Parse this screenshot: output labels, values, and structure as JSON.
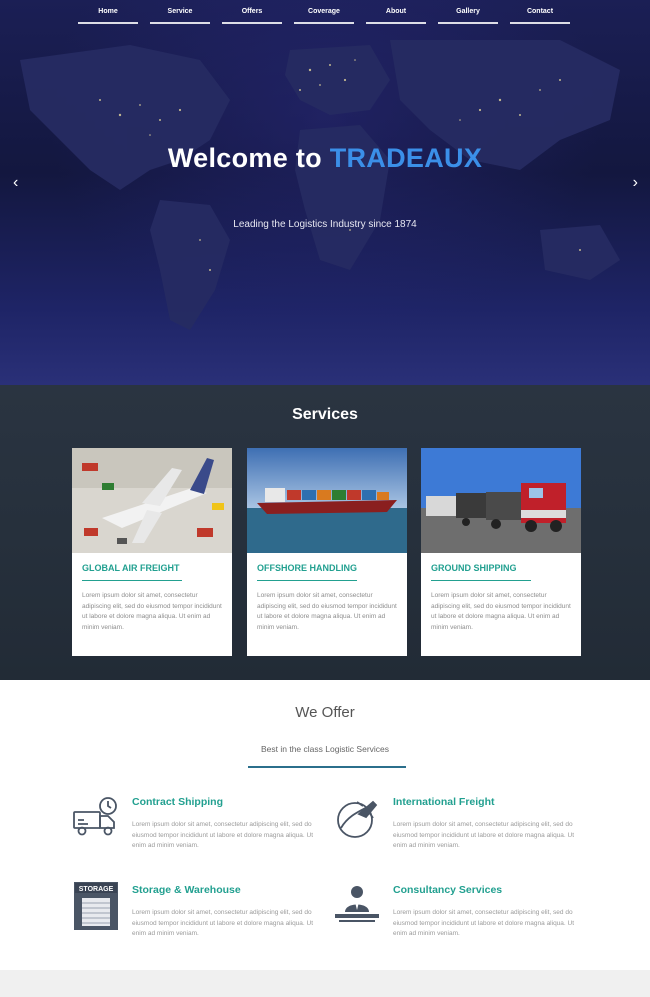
{
  "nav": {
    "items": [
      "Home",
      "Service",
      "Offers",
      "Coverage",
      "About",
      "Gallery",
      "Contact"
    ]
  },
  "hero": {
    "title_prefix": "Welcome to",
    "title_brand": "TRADEAUX",
    "subtitle": "Leading the Logistics Industry since 1874",
    "prev_glyph": "‹",
    "next_glyph": "›"
  },
  "services": {
    "title": "Services",
    "cards": [
      {
        "title": "GLOBAL AIR FREIGHT",
        "text": "Lorem ipsum dolor sit amet, consectetur adipiscing elit, sed do eiusmod tempor incididunt ut labore et dolore magna aliqua. Ut enim ad minim veniam."
      },
      {
        "title": "OFFSHORE HANDLING",
        "text": "Lorem ipsum dolor sit amet, consectetur adipiscing elit, sed do eiusmod tempor incididunt ut labore et dolore magna aliqua. Ut enim ad minim veniam."
      },
      {
        "title": "GROUND SHIPPING",
        "text": "Lorem ipsum dolor sit amet, consectetur adipiscing elit, sed do eiusmod tempor incididunt ut labore et dolore magna aliqua. Ut enim ad minim veniam."
      }
    ]
  },
  "offer": {
    "title": "We Offer",
    "subtitle": "Best in the class Logistic Services",
    "items": [
      {
        "title": "Contract Shipping",
        "icon": "delivery-truck-clock-icon",
        "text": "Lorem ipsum dolor sit amet, consectetur adipiscing elit, sed do eiusmod tempor incididunt ut labore et dolore magna aliqua. Ut enim ad minim veniam."
      },
      {
        "title": "International Freight",
        "icon": "globe-airplane-icon",
        "text": "Lorem ipsum dolor sit amet, consectetur adipiscing elit, sed do eiusmod tempor incididunt ut labore et dolore magna aliqua. Ut enim ad minim veniam."
      },
      {
        "title": "Storage & Warehouse",
        "icon": "storage-warehouse-icon",
        "storage_label": "STORAGE",
        "text": "Lorem ipsum dolor sit amet, consectetur adipiscing elit, sed do eiusmod tempor incididunt ut labore et dolore magna aliqua. Ut enim ad minim veniam."
      },
      {
        "title": "Consultancy Services",
        "icon": "consultant-desk-icon",
        "text": "Lorem ipsum dolor sit amet, consectetur adipiscing elit, sed do eiusmod tempor incididunt ut labore et dolore magna aliqua. Ut enim ad minim veniam."
      }
    ]
  },
  "colors": {
    "accent_teal": "#22a090",
    "brand_blue": "#3b8fe8",
    "hero_dark": "#13173f",
    "services_bg": "#26303c",
    "rule_blue": "#2b6f8c"
  }
}
